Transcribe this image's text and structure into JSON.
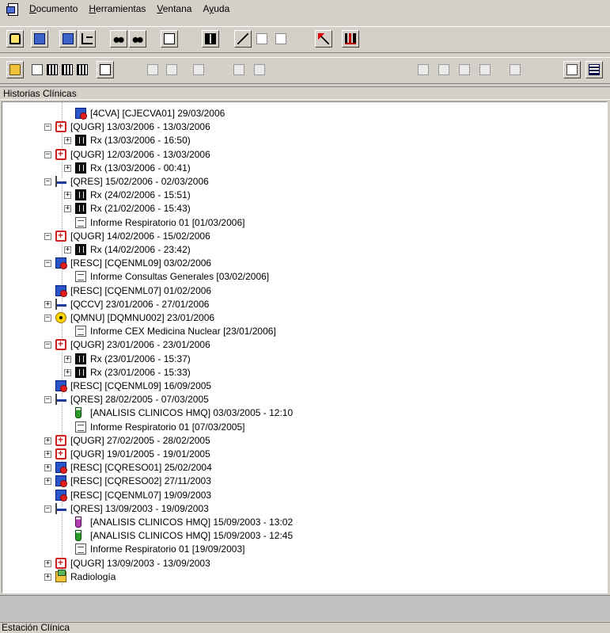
{
  "menu": {
    "items": [
      {
        "pre": "",
        "key": "D",
        "post": "ocumento"
      },
      {
        "pre": "",
        "key": "H",
        "post": "erramientas"
      },
      {
        "pre": "",
        "key": "V",
        "post": "entana"
      },
      {
        "pre": "A",
        "key": "y",
        "post": "uda"
      }
    ]
  },
  "panel": {
    "title": "Historias Clínicas"
  },
  "status": {
    "text": "Estación Clínica"
  },
  "tree": [
    {
      "indent": 4,
      "icon": "consult",
      "exp": "",
      "text": "[4CVA] [CJECVA01] 29/03/2006"
    },
    {
      "indent": 3,
      "icon": "case",
      "exp": "-",
      "text": "[QUGR] 13/03/2006 - 13/03/2006"
    },
    {
      "indent": 4,
      "icon": "xray",
      "exp": "+",
      "text": "Rx (13/03/2006 - 16:50)"
    },
    {
      "indent": 3,
      "icon": "case",
      "exp": "-",
      "text": "[QUGR] 12/03/2006 - 13/03/2006"
    },
    {
      "indent": 4,
      "icon": "xray",
      "exp": "+",
      "text": "Rx (13/03/2006 - 00:41)"
    },
    {
      "indent": 3,
      "icon": "bed",
      "exp": "-",
      "text": "[QRES] 15/02/2006 - 02/03/2006"
    },
    {
      "indent": 4,
      "icon": "xray",
      "exp": "+",
      "text": "Rx (24/02/2006 - 15:51)"
    },
    {
      "indent": 4,
      "icon": "xray",
      "exp": "+",
      "text": "Rx (21/02/2006 - 15:43)"
    },
    {
      "indent": 4,
      "icon": "report",
      "exp": "",
      "text": "Informe Respiratorio 01 [01/03/2006]"
    },
    {
      "indent": 3,
      "icon": "case",
      "exp": "-",
      "text": "[QUGR] 14/02/2006 - 15/02/2006"
    },
    {
      "indent": 4,
      "icon": "xray",
      "exp": "+",
      "text": "Rx (14/02/2006 - 23:42)"
    },
    {
      "indent": 3,
      "icon": "consult",
      "exp": "-",
      "text": "[RESC] [CQENML09] 03/02/2006"
    },
    {
      "indent": 4,
      "icon": "report",
      "exp": "",
      "text": "Informe Consultas Generales [03/02/2006]"
    },
    {
      "indent": 3,
      "icon": "consult",
      "exp": "",
      "text": "[RESC] [CQENML07] 01/02/2006"
    },
    {
      "indent": 3,
      "icon": "bed",
      "exp": "+",
      "text": "[QCCV] 23/01/2006 - 27/01/2006"
    },
    {
      "indent": 3,
      "icon": "nuke",
      "exp": "-",
      "text": "[QMNU] [DQMNU002] 23/01/2006"
    },
    {
      "indent": 4,
      "icon": "report",
      "exp": "",
      "text": "Informe CEX Medicina Nuclear [23/01/2006]"
    },
    {
      "indent": 3,
      "icon": "case",
      "exp": "-",
      "text": "[QUGR] 23/01/2006 - 23/01/2006"
    },
    {
      "indent": 4,
      "icon": "xray",
      "exp": "+",
      "text": "Rx (23/01/2006 - 15:37)"
    },
    {
      "indent": 4,
      "icon": "xray",
      "exp": "+",
      "text": "Rx (23/01/2006 - 15:33)"
    },
    {
      "indent": 3,
      "icon": "consult",
      "exp": "",
      "text": "[RESC] [CQENML09] 16/09/2005"
    },
    {
      "indent": 3,
      "icon": "bed",
      "exp": "-",
      "text": "[QRES] 28/02/2005 - 07/03/2005"
    },
    {
      "indent": 4,
      "icon": "lab",
      "exp": "",
      "text": "[ANALISIS CLINICOS HMQ]  03/03/2005 - 12:10"
    },
    {
      "indent": 4,
      "icon": "report",
      "exp": "",
      "text": "Informe Respiratorio 01 [07/03/2005]"
    },
    {
      "indent": 3,
      "icon": "case",
      "exp": "+",
      "text": "[QUGR] 27/02/2005 - 28/02/2005"
    },
    {
      "indent": 3,
      "icon": "case",
      "exp": "+",
      "text": "[QUGR] 19/01/2005 - 19/01/2005"
    },
    {
      "indent": 3,
      "icon": "consult",
      "exp": "+",
      "text": "[RESC] [CQRESO01] 25/02/2004"
    },
    {
      "indent": 3,
      "icon": "consult",
      "exp": "+",
      "text": "[RESC] [CQRESO02] 27/11/2003"
    },
    {
      "indent": 3,
      "icon": "consult",
      "exp": "",
      "text": "[RESC] [CQENML07] 19/09/2003"
    },
    {
      "indent": 3,
      "icon": "bed",
      "exp": "-",
      "text": "[QRES] 13/09/2003 - 19/09/2003"
    },
    {
      "indent": 4,
      "icon": "lab-p",
      "exp": "",
      "text": "[ANALISIS CLINICOS HMQ]  15/09/2003 - 13:02"
    },
    {
      "indent": 4,
      "icon": "lab",
      "exp": "",
      "text": "[ANALISIS CLINICOS HMQ]  15/09/2003 - 12:45"
    },
    {
      "indent": 4,
      "icon": "report",
      "exp": "",
      "text": "Informe Respiratorio 01 [19/09/2003]"
    },
    {
      "indent": 3,
      "icon": "case",
      "exp": "+",
      "text": "[QUGR] 13/09/2003 - 13/09/2003"
    },
    {
      "indent": 3,
      "icon": "folder",
      "exp": "+",
      "text": "Radiología"
    }
  ]
}
